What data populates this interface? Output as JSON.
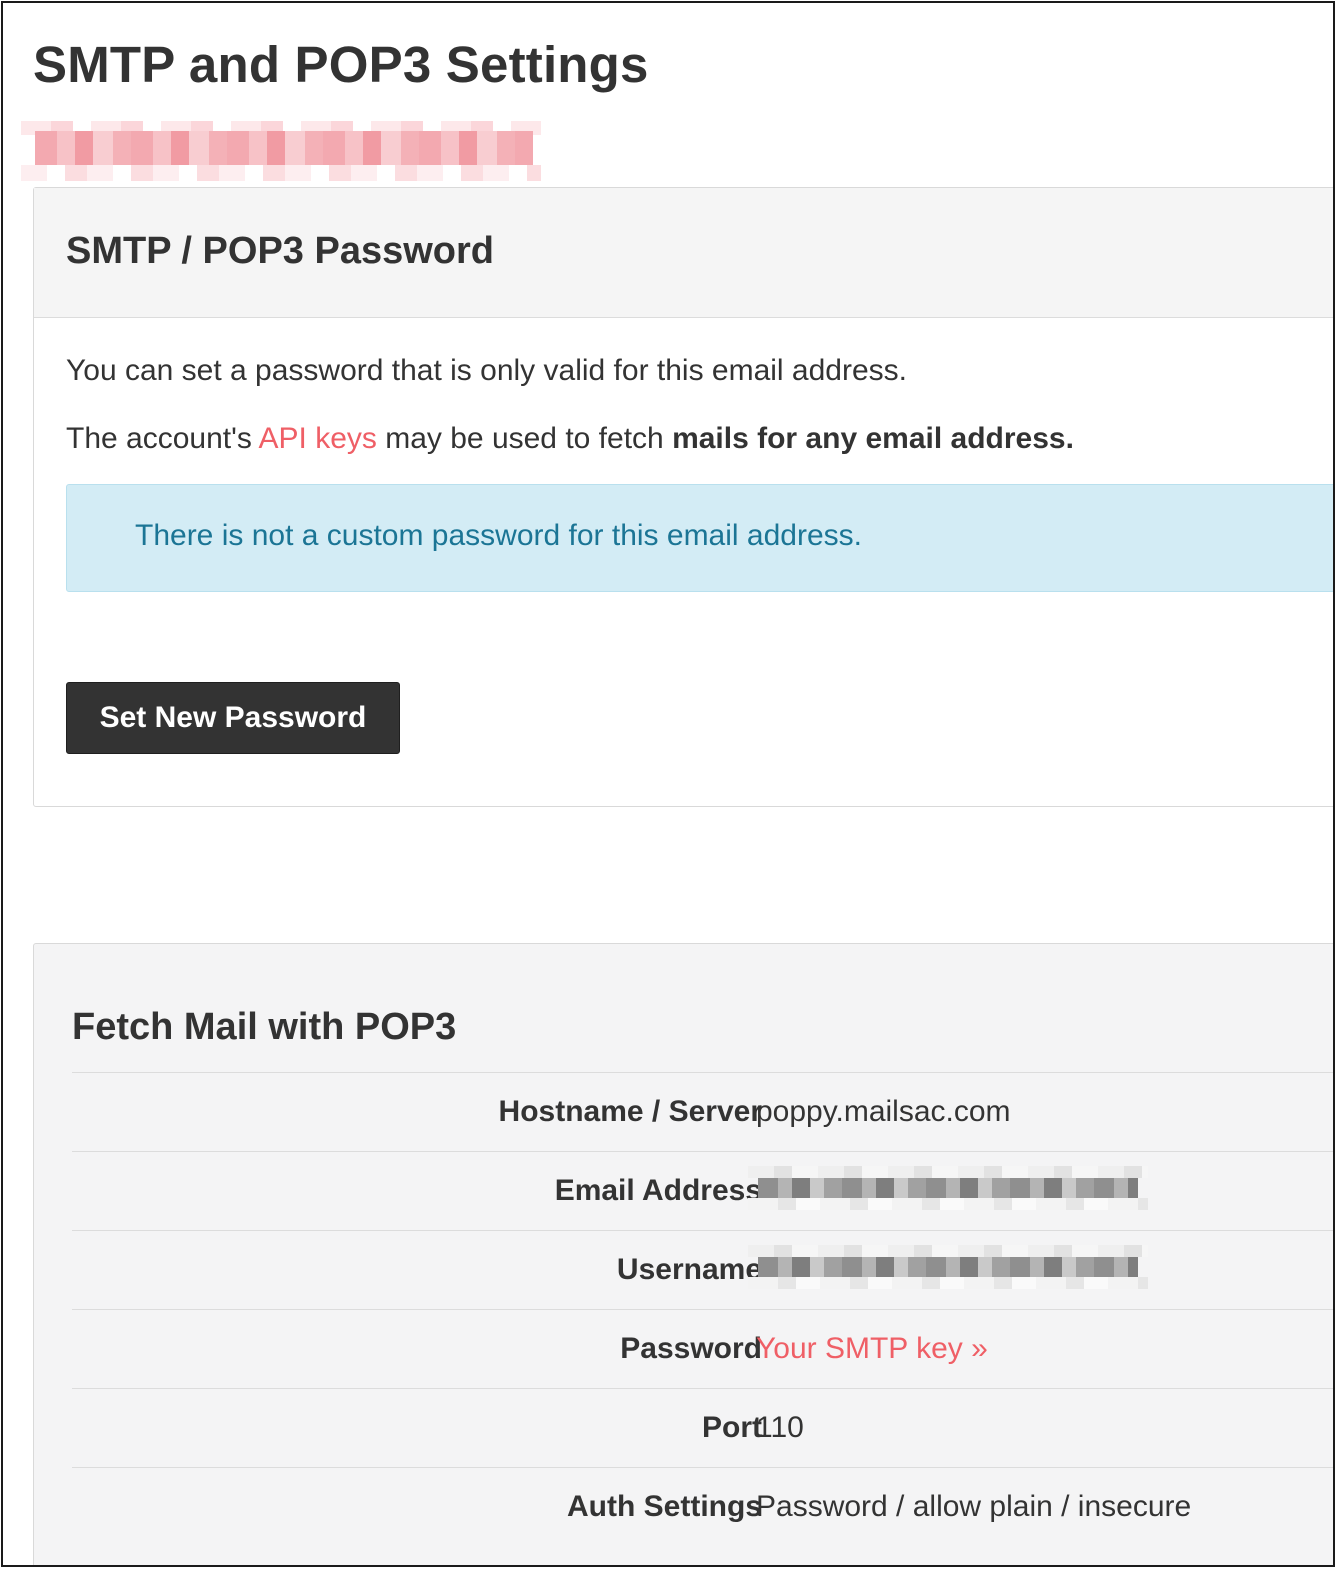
{
  "page": {
    "title": "SMTP and POP3 Settings",
    "subtitle_redacted": "email address (redacted)"
  },
  "password_panel": {
    "title": "SMTP / POP3 Password",
    "line1": "You can set a password that is only valid for this email address.",
    "line2_prefix": "The account's ",
    "line2_link": "API keys",
    "line2_middle": " may be used to fetch ",
    "line2_bold": "mails for any email address.",
    "alert": "There is not a custom password for this email address.",
    "button": "Set New Password"
  },
  "pop3_panel": {
    "title": "Fetch Mail with POP3",
    "rows": [
      {
        "label": "Hostname / Server",
        "value": "poppy.mailsac.com"
      },
      {
        "label": "Email Address",
        "value": "(redacted)"
      },
      {
        "label": "Username",
        "value": "(redacted)"
      },
      {
        "label": "Password",
        "value": "Your SMTP key »"
      },
      {
        "label": "Port",
        "value": "110"
      },
      {
        "label": "Auth Settings",
        "value": "Password / allow plain / insecure"
      }
    ]
  },
  "colors": {
    "link": "#ef5f66",
    "alert_bg": "#d3ecf5",
    "alert_text": "#1b7595",
    "button_bg": "#333333",
    "redaction": "#f3a9b0"
  }
}
